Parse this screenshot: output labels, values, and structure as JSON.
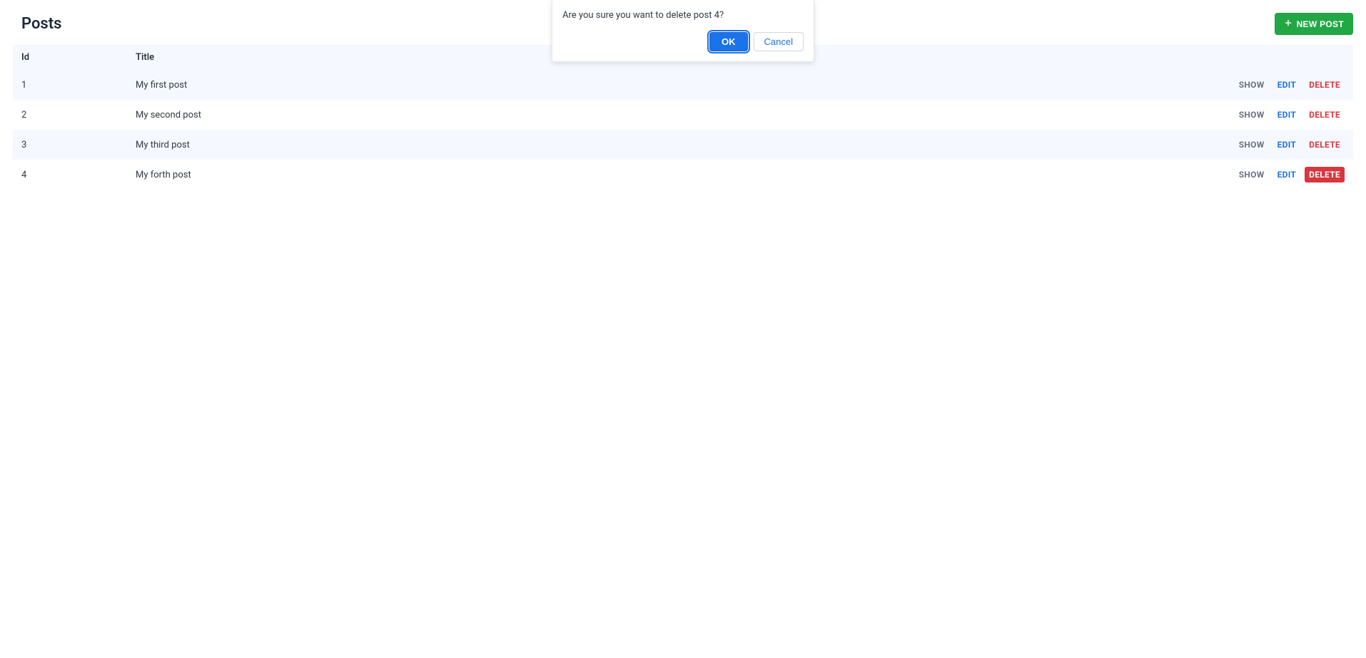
{
  "page": {
    "title": "Posts",
    "new_button_label": "NEW POST"
  },
  "table": {
    "headers": {
      "id": "Id",
      "title": "Title"
    },
    "rows": [
      {
        "id": "1",
        "title": "My first post",
        "delete_active": false
      },
      {
        "id": "2",
        "title": "My second post",
        "delete_active": false
      },
      {
        "id": "3",
        "title": "My third post",
        "delete_active": false
      },
      {
        "id": "4",
        "title": "My forth post",
        "delete_active": true
      }
    ]
  },
  "actions": {
    "show": "SHOW",
    "edit": "EDIT",
    "delete": "DELETE"
  },
  "confirm_dialog": {
    "message": "Are you sure you want to delete post 4?",
    "ok_label": "OK",
    "cancel_label": "Cancel"
  }
}
